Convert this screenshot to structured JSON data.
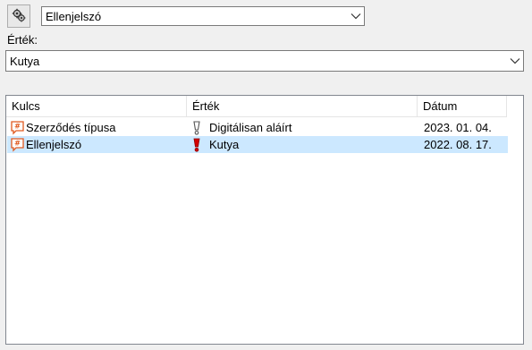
{
  "toolbar": {
    "settings_icon": "gears-icon",
    "key_selected": "Ellenjelszó"
  },
  "value_field": {
    "label": "Érték:",
    "selected": "Kutya"
  },
  "table": {
    "columns": [
      "Kulcs",
      "Érték",
      "Dátum"
    ],
    "rows": [
      {
        "key": "Szerződés típusa",
        "value": "Digitálisan aláírt",
        "date": "2023. 01. 04.",
        "selected": false,
        "value_icon": "exclamation-outline-icon"
      },
      {
        "key": "Ellenjelszó",
        "value": "Kutya",
        "date": "2022. 08. 17.",
        "selected": true,
        "value_icon": "exclamation-red-icon"
      }
    ]
  },
  "colors": {
    "selection": "#cce8ff",
    "tag_icon": "#e05a20",
    "exclamation": "#d40000"
  }
}
